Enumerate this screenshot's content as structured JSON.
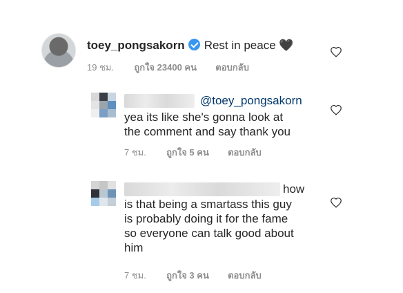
{
  "post_comment": {
    "username": "toey_pongsakorn",
    "text": "Rest in peace",
    "emoji": "🖤",
    "time": "19 ชม.",
    "likes": "ถูกใจ 23400 คน",
    "reply": "ตอบกลับ"
  },
  "replies": [
    {
      "mention": "@toey_pongsakorn",
      "lines": [
        "yea its like she's gonna look at",
        "the comment and say thank you"
      ],
      "time": "7 ชม.",
      "likes": "ถูกใจ 5 คน",
      "reply": "ตอบกลับ"
    },
    {
      "lead_word": "how",
      "lines": [
        "is that being a smartass this guy",
        "is probably doing it for the fame",
        "so everyone can talk good about",
        "him"
      ],
      "time": "7 ชม.",
      "likes": "ถูกใจ 3 คน",
      "reply": "ตอบกลับ"
    }
  ],
  "icons": {
    "like": "heart-outline-icon",
    "verified": "verified-badge-icon"
  },
  "colors": {
    "verified": "#3897f0",
    "meta": "#8e8e8e",
    "mention": "#00376b"
  }
}
